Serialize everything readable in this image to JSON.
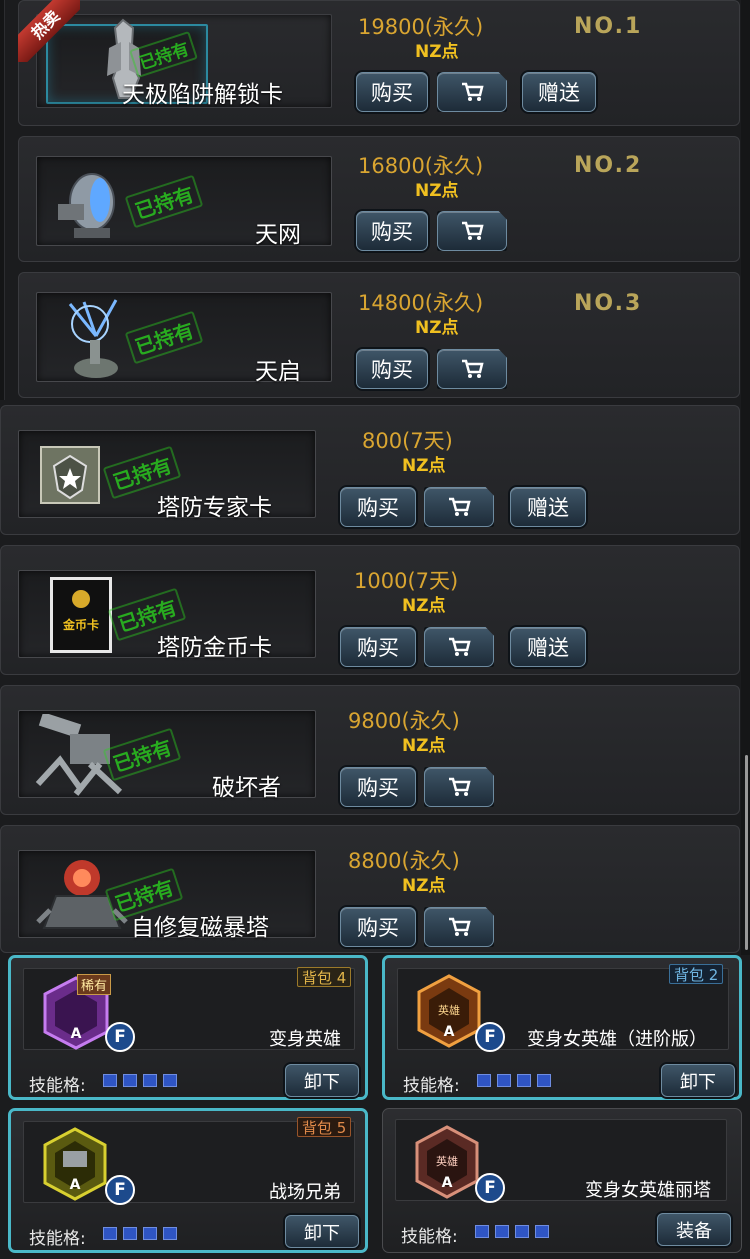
{
  "colors": {
    "price": "#d9a531",
    "currency": "#f0c020",
    "owned_stamp": "#2bd21f",
    "selected_border": "#4ab8c8",
    "button": "#2c3f50",
    "hot_ribbon": "#b6342c"
  },
  "labels": {
    "buy": "购买",
    "gift": "赠送",
    "owned": "已持有",
    "hot": "热卖",
    "unequip": "卸下",
    "equip": "装备",
    "skill_slots": "技能格:",
    "rare": "稀有",
    "cart_icon": "shopping-cart-icon",
    "f_badge": "F",
    "grade_a": "A"
  },
  "shop_items": [
    {
      "name": "天极陷阱解锁卡",
      "price": "19800(永久)",
      "currency": "NZ点",
      "rank": "NO.1",
      "owned": true,
      "hot": true,
      "gift": true
    },
    {
      "name": "天网",
      "price": "16800(永久)",
      "currency": "NZ点",
      "rank": "NO.2",
      "owned": true,
      "hot": false,
      "gift": false
    },
    {
      "name": "天启",
      "price": "14800(永久)",
      "currency": "NZ点",
      "rank": "NO.3",
      "owned": true,
      "hot": false,
      "gift": false
    },
    {
      "name": "塔防专家卡",
      "price": "800(7天)",
      "currency": "NZ点",
      "owned": true,
      "gift": true
    },
    {
      "name": "塔防金币卡",
      "price": "1000(7天)",
      "currency": "NZ点",
      "owned": true,
      "gift": true,
      "thumb_text": "金币卡"
    },
    {
      "name": "破坏者",
      "price": "9800(永久)",
      "currency": "NZ点",
      "owned": true,
      "gift": false
    },
    {
      "name": "自修复磁暴塔",
      "price": "8800(永久)",
      "currency": "NZ点",
      "owned": true,
      "gift": false
    }
  ],
  "heroes": [
    {
      "name": "变身英雄",
      "bag": "背包 4",
      "tag": "稀有",
      "emblem_text": "稀有",
      "action": "卸下",
      "equipped": true,
      "skill_slots": 4
    },
    {
      "name": "变身女英雄（进阶版）",
      "bag": "背包 2",
      "emblem_text": "英雄",
      "action": "卸下",
      "equipped": true,
      "skill_slots": 4
    },
    {
      "name": "战场兄弟",
      "bag": "背包 5",
      "action": "卸下",
      "equipped": true,
      "skill_slots": 4
    },
    {
      "name": "变身女英雄丽塔",
      "emblem_text": "英雄",
      "action": "装备",
      "equipped": false,
      "skill_slots": 4
    }
  ]
}
